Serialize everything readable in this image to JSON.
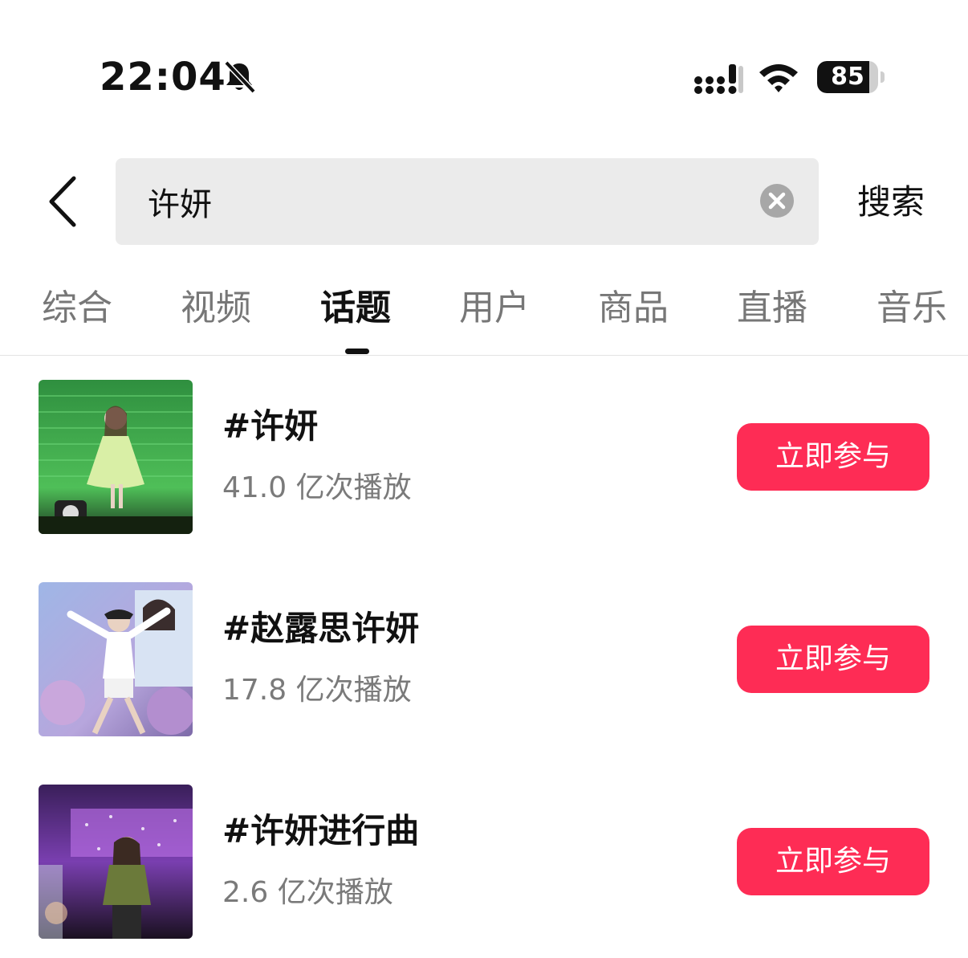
{
  "status_bar": {
    "time": "22:04",
    "battery_level": 85,
    "battery_text": "85",
    "icons": [
      "bell-slash-icon",
      "signal-icon",
      "wifi-icon",
      "battery-icon"
    ]
  },
  "search": {
    "query": "许妍",
    "submit_label": "搜索",
    "back_icon": "chevron-left-icon",
    "clear_icon": "clear-circle-icon"
  },
  "tabs": {
    "items": [
      {
        "label": "综合"
      },
      {
        "label": "视频"
      },
      {
        "label": "话题"
      },
      {
        "label": "用户"
      },
      {
        "label": "商品"
      },
      {
        "label": "直播"
      },
      {
        "label": "音乐"
      }
    ],
    "active_index": 2
  },
  "topics": [
    {
      "title": "#许妍",
      "plays": "41.0 亿次播放",
      "button": "立即参与"
    },
    {
      "title": "#赵露思许妍",
      "plays": "17.8 亿次播放",
      "button": "立即参与"
    },
    {
      "title": "#许妍进行曲",
      "plays": "2.6 亿次播放",
      "button": "立即参与"
    }
  ],
  "colors": {
    "accent": "#fe2c55",
    "search_bg": "#ebebeb",
    "muted_text": "#7a7a7a"
  }
}
